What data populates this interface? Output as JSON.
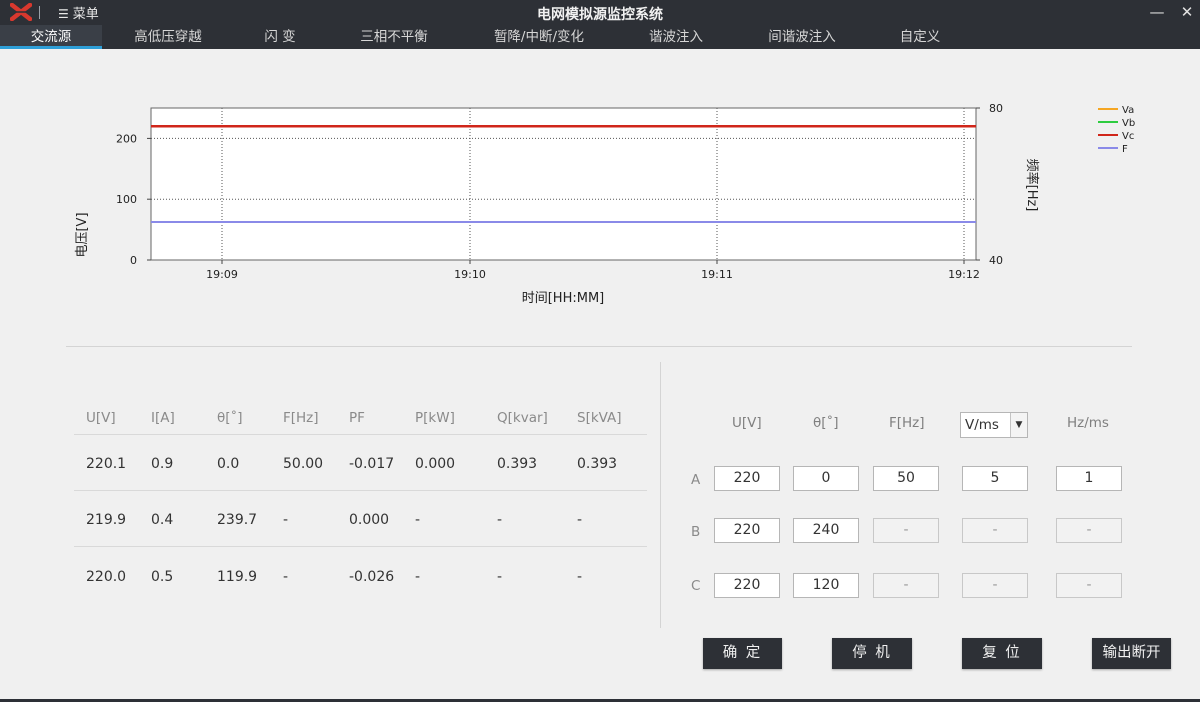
{
  "app": {
    "title": "电网模拟源监控系统",
    "menu_label": "菜单"
  },
  "tabs": [
    "交流源",
    "高低压穿越",
    "闪 变",
    "三相不平衡",
    "暂降/中断/变化",
    "谐波注入",
    "间谐波注入",
    "自定义"
  ],
  "colors": {
    "accent": "#2e9fd8",
    "dark": "#2d3036",
    "Va": "#f5a623",
    "Vb": "#2ecc40",
    "Vc": "#d0261a",
    "F": "#8a8ae8"
  },
  "chart_data": {
    "type": "line",
    "xlabel": "时间[HH:MM]",
    "ylabel": "电压[V]",
    "y2label": "频率[Hz]",
    "x_ticks": [
      "19:09",
      "19:10",
      "19:11",
      "19:12"
    ],
    "ylim": [
      0,
      250
    ],
    "y_ticks": [
      "0",
      "100",
      "200"
    ],
    "y2lim": [
      40,
      80
    ],
    "y2_ticks": [
      "40",
      "80"
    ],
    "legend_position": "top-right",
    "grid": true,
    "series": [
      {
        "name": "Va",
        "axis": "left",
        "values": [
          220,
          220
        ]
      },
      {
        "name": "Vb",
        "axis": "left",
        "values": [
          220,
          220
        ]
      },
      {
        "name": "Vc",
        "axis": "left",
        "values": [
          220,
          220
        ]
      },
      {
        "name": "F",
        "axis": "right",
        "values": [
          50,
          50
        ]
      }
    ]
  },
  "measure": {
    "headers": [
      "U[V]",
      "I[A]",
      "θ[˚]",
      "F[Hz]",
      "PF",
      "P[kW]",
      "Q[kvar]",
      "S[kVA]"
    ],
    "rows": [
      [
        "220.1",
        "0.9",
        "0.0",
        "50.00",
        "-0.017",
        "0.000",
        "0.393",
        "0.393"
      ],
      [
        "219.9",
        "0.4",
        "239.7",
        "-",
        "0.000",
        "-",
        "-",
        "-"
      ],
      [
        "220.0",
        "0.5",
        "119.9",
        "-",
        "-0.026",
        "-",
        "-",
        "-"
      ]
    ]
  },
  "control": {
    "headers": [
      "U[V]",
      "θ[˚]",
      "F[Hz]",
      "Hz/ms"
    ],
    "rate_unit": "V/ms",
    "rows": [
      {
        "label": "A",
        "values": [
          "220",
          "0",
          "50",
          "5",
          "1"
        ]
      },
      {
        "label": "B",
        "values": [
          "220",
          "240",
          "-",
          "-",
          "-"
        ]
      },
      {
        "label": "C",
        "values": [
          "220",
          "120",
          "-",
          "-",
          "-"
        ]
      }
    ],
    "buttons": {
      "confirm": "确 定",
      "stop": "停 机",
      "reset": "复 位",
      "disconnect": "输出断开"
    }
  }
}
